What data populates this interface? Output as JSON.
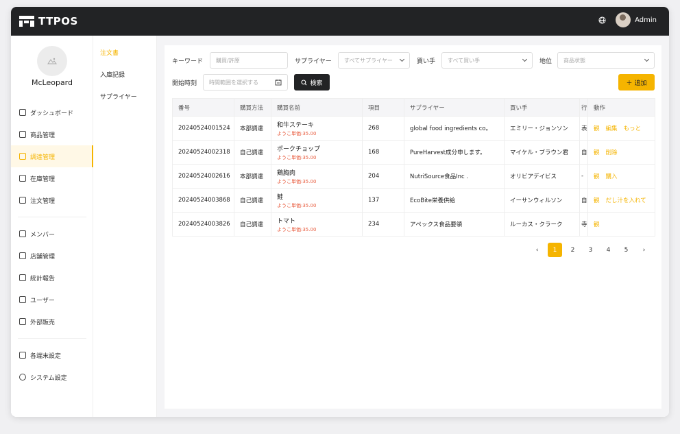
{
  "brand": {
    "name": "TTPOS"
  },
  "topbar": {
    "user": "Admin",
    "globe_icon": "globe-icon"
  },
  "sidebar": {
    "username": "McLeopard",
    "items": [
      {
        "label": "ダッシュボード",
        "icon": "dashboard-icon"
      },
      {
        "label": "商品管理",
        "icon": "box-icon"
      },
      {
        "label": "調達管理",
        "icon": "cart-icon",
        "active": true
      },
      {
        "label": "在庫管理",
        "icon": "inventory-icon"
      },
      {
        "label": "注文管理",
        "icon": "clipboard-icon"
      },
      {
        "label": "メンバー",
        "icon": "member-icon"
      },
      {
        "label": "店舗管理",
        "icon": "store-icon"
      },
      {
        "label": "統計報告",
        "icon": "report-icon"
      },
      {
        "label": "ユーザー",
        "icon": "users-icon"
      },
      {
        "label": "外部販売",
        "icon": "external-sales-icon"
      },
      {
        "label": "各端末設定",
        "icon": "terminal-icon"
      },
      {
        "label": "システム設定",
        "icon": "gear-icon"
      }
    ]
  },
  "subnav": {
    "items": [
      "注文書",
      "入庫記録",
      "サプライヤー"
    ]
  },
  "filters": {
    "keyword_label": "キーワード",
    "keyword_placeholder": "購買/許原",
    "supplier_label": "サプライヤー",
    "supplier_value": "すべてサプライヤー",
    "buyer_label": "買い手",
    "buyer_value": "すべて買い手",
    "status_label": "地位",
    "status_value": "商品状態",
    "start_label": "開始時刻",
    "start_placeholder": "時間範囲を選択する",
    "search_label": "検索",
    "add_label": "追加"
  },
  "table": {
    "headers": [
      "番号",
      "購買方法",
      "購買名前",
      "項目",
      "サプライヤー",
      "買い手",
      "行",
      "動作"
    ],
    "rows": [
      {
        "no": "20240524001524",
        "method": "本部調達",
        "name": "和牛ステーキ",
        "price": "ようこ単価:35.00",
        "items": "268",
        "supplier": "global food ingredients co。",
        "buyer": "エミリー・ジョンソン",
        "extra": "表",
        "actions": [
          "観",
          "編集",
          "もっと"
        ]
      },
      {
        "no": "20240524002318",
        "method": "自己調達",
        "name": "ポークチョップ",
        "price": "ようこ単価:35.00",
        "items": "168",
        "supplier": "PureHarvest成分申します。",
        "buyer": "マイケル・ブラウン君",
        "extra": "自",
        "actions": [
          "観",
          "削除"
        ]
      },
      {
        "no": "20240524002616",
        "method": "本部調達",
        "name": "鶏胸肉",
        "price": "ようこ単価:35.00",
        "items": "204",
        "supplier": "NutriSource食品Inc .",
        "buyer": "オリビアデイビス",
        "extra": "-",
        "actions": [
          "観",
          "購入"
        ]
      },
      {
        "no": "20240524003868",
        "method": "自己調達",
        "name": "鮭",
        "price": "ようこ単価:35.00",
        "items": "137",
        "supplier": "EcoBite栄養供給",
        "buyer": "イーサンウィルソン",
        "extra": "自",
        "actions": [
          "観",
          "だし汁を入れて"
        ]
      },
      {
        "no": "20240524003826",
        "method": "自己調達",
        "name": "トマト",
        "price": "ようこ単価:35.00",
        "items": "234",
        "supplier": "アペックス食品要領",
        "buyer": "ルーカス・クラーク",
        "extra": "寺",
        "actions": [
          "観"
        ]
      }
    ]
  },
  "pagination": {
    "pages": [
      "1",
      "2",
      "3",
      "4",
      "5"
    ],
    "current": "1",
    "prev": "‹",
    "next": "›"
  }
}
